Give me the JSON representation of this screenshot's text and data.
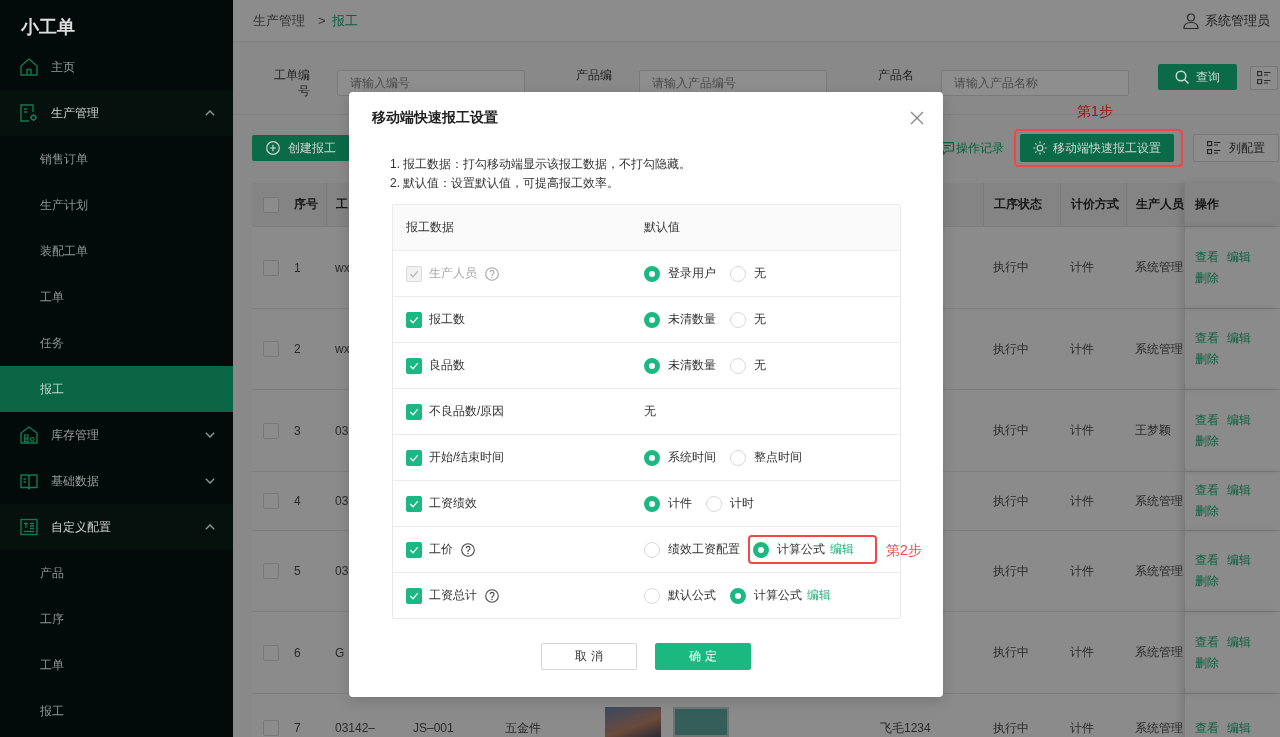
{
  "sidebar": {
    "title": "小工单",
    "items": [
      {
        "label": "主页",
        "kind": "link",
        "selected": false
      },
      {
        "label": "生产管理",
        "kind": "group",
        "selected": false,
        "expanded": true,
        "children": [
          {
            "label": "销售订单",
            "selected": false
          },
          {
            "label": "生产计划",
            "selected": false
          },
          {
            "label": "装配工单",
            "selected": false
          },
          {
            "label": "工单",
            "selected": false
          },
          {
            "label": "任务",
            "selected": false
          },
          {
            "label": "报工",
            "selected": true
          }
        ]
      },
      {
        "label": "库存管理",
        "kind": "group",
        "selected": false,
        "expanded": false
      },
      {
        "label": "基础数据",
        "kind": "group",
        "selected": false,
        "expanded": false
      },
      {
        "label": "自定义配置",
        "kind": "group",
        "selected": false,
        "expanded": true,
        "children": [
          {
            "label": "产品",
            "selected": false
          },
          {
            "label": "工序",
            "selected": false
          },
          {
            "label": "工单",
            "selected": false
          },
          {
            "label": "报工",
            "selected": false
          }
        ]
      }
    ]
  },
  "header": {
    "breadcrumb": [
      {
        "label": "生产管理",
        "current": false
      },
      {
        "label": "报工",
        "current": true
      }
    ],
    "separator": ">",
    "user": "系统管理员"
  },
  "filters": [
    {
      "label": "工单编号",
      "placeholder": "请输入编号"
    },
    {
      "label": "产品编",
      "placeholder": "请输入产品编号"
    },
    {
      "label": "产品名",
      "placeholder": "请输入产品名称"
    }
  ],
  "search_button": "查询",
  "toolbar": {
    "create_button": "创建报工",
    "log_link": "操作记录",
    "mobile_button": {
      "label": "移动端快速报工设置",
      "callout": "第1步"
    },
    "columns_button": "列配置"
  },
  "table": {
    "header_checked": false,
    "header": {
      "number": "序号",
      "column_3": "工",
      "status": "工序状态",
      "pricing": "计价方式",
      "worker": "生产人员",
      "actions": "操作"
    },
    "rows": [
      {
        "checked": false,
        "number": "1",
        "column_3": "wx",
        "status": "执行中",
        "pricing": "计件",
        "worker": "系统管理",
        "actions": [
          "查看",
          "编辑",
          "删除"
        ]
      },
      {
        "checked": false,
        "number": "2",
        "column_3": "wx",
        "status": "执行中",
        "pricing": "计件",
        "worker": "系统管理",
        "actions": [
          "查看",
          "编辑",
          "删除"
        ]
      },
      {
        "checked": false,
        "number": "3",
        "column_3": "03",
        "status": "执行中",
        "pricing": "计件",
        "worker": "王梦颖",
        "actions": [
          "查看",
          "编辑",
          "删除"
        ]
      },
      {
        "checked": false,
        "number": "4",
        "column_3": "03",
        "status": "执行中",
        "pricing": "计件",
        "worker": "系统管理",
        "actions": [
          "查看",
          "编辑",
          "删除"
        ]
      },
      {
        "checked": false,
        "number": "5",
        "column_3": "03",
        "status": "执行中",
        "pricing": "计件",
        "worker": "系统管理",
        "actions": [
          "查看",
          "编辑",
          "删除"
        ]
      },
      {
        "checked": false,
        "number": "6",
        "column_3": "G",
        "status": "执行中",
        "pricing": "计件",
        "worker": "系统管理",
        "actions": [
          "查看",
          "编辑",
          "删除"
        ]
      },
      {
        "checked": false,
        "number": "7",
        "column_3": "03142–",
        "column_4": "JS–001",
        "column_5": "五金件",
        "images": [
          {
            "kind": "photo"
          },
          {
            "kind": "cover"
          }
        ],
        "column_8": "飞毛1234",
        "status": "执行中",
        "pricing": "计件",
        "worker": "系统管理",
        "actions": [
          "查看",
          "编辑"
        ]
      }
    ]
  },
  "modal": {
    "title": "移动端快速报工设置",
    "notes": [
      "1. 报工数据：打勾移动端显示该报工数据，不打勾隐藏。",
      "2. 默认值：设置默认值，可提高报工效率。"
    ],
    "columns": [
      "报工数据",
      "默认值"
    ],
    "rows": [
      {
        "label": "生产人员",
        "checked": true,
        "disabled": true,
        "help": true,
        "kind": "radio",
        "options": [
          {
            "label": "登录用户",
            "selected": true
          },
          {
            "label": "无",
            "selected": false
          }
        ]
      },
      {
        "label": "报工数",
        "checked": true,
        "disabled": false,
        "help": false,
        "kind": "radio",
        "options": [
          {
            "label": "未清数量",
            "selected": true
          },
          {
            "label": "无",
            "selected": false
          }
        ]
      },
      {
        "label": "良品数",
        "checked": true,
        "disabled": false,
        "help": false,
        "kind": "radio",
        "options": [
          {
            "label": "未清数量",
            "selected": true
          },
          {
            "label": "无",
            "selected": false
          }
        ]
      },
      {
        "label": "不良品数/原因",
        "checked": true,
        "disabled": false,
        "help": false,
        "kind": "text",
        "value": "无"
      },
      {
        "label": "开始/结束时间",
        "checked": true,
        "disabled": false,
        "help": false,
        "kind": "radio",
        "options": [
          {
            "label": "系统时间",
            "selected": true
          },
          {
            "label": "整点时间",
            "selected": false
          }
        ]
      },
      {
        "label": "工资绩效",
        "checked": true,
        "disabled": false,
        "help": false,
        "kind": "radio",
        "options": [
          {
            "label": "计件",
            "selected": true
          },
          {
            "label": "计时",
            "selected": false
          }
        ]
      },
      {
        "label": "工价",
        "checked": true,
        "disabled": false,
        "help": true,
        "kind": "radio",
        "options": [
          {
            "label": "绩效工资配置",
            "selected": false
          },
          {
            "label": "计算公式",
            "selected": true,
            "link": "编辑",
            "callout": "第2步"
          }
        ]
      },
      {
        "label": "工资总计",
        "checked": true,
        "disabled": false,
        "help": true,
        "kind": "radio",
        "options": [
          {
            "label": "默认公式",
            "selected": false
          },
          {
            "label": "计算公式",
            "selected": true,
            "link": "编辑"
          }
        ]
      }
    ],
    "buttons": [
      {
        "label": "取 消",
        "kind": "default"
      },
      {
        "label": "确 定",
        "kind": "primary"
      }
    ]
  }
}
